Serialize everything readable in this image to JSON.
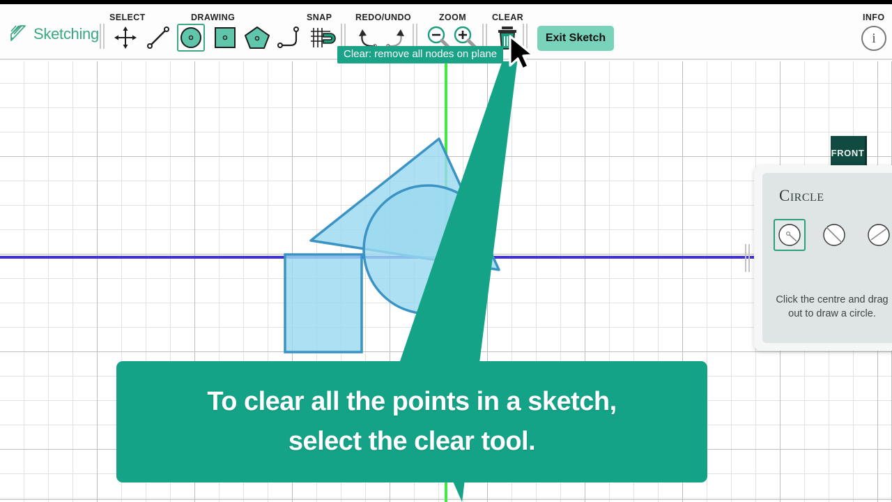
{
  "app": {
    "name": "Sketching",
    "logo_icon": "pencil-icon"
  },
  "toolbar": {
    "groups": [
      {
        "label": "SELECT"
      },
      {
        "label": "DRAWING"
      },
      {
        "label": "SNAP"
      },
      {
        "label": "REDO/UNDO"
      },
      {
        "label": "ZOOM"
      },
      {
        "label": "CLEAR"
      },
      {
        "label": "INFO"
      }
    ],
    "tools": {
      "move": "move-crosshair-icon",
      "line": "line-tool-icon",
      "circle": "circle-tool-icon",
      "square": "square-tool-icon",
      "pentagon": "pentagon-tool-icon",
      "fillet": "fillet-tool-icon",
      "snap": "snap-magnet-icon",
      "undo": "undo-arrow-icon",
      "redo": "redo-arrow-icon",
      "zoom_out": "zoom-out-icon",
      "zoom_in": "zoom-in-icon",
      "clear": "trash-icon"
    },
    "selected_tool": "circle",
    "exit_label": "Exit Sketch",
    "info_glyph": "i"
  },
  "tooltip": {
    "text": "Clear: remove all nodes on plane"
  },
  "viewcube": {
    "label": "FRONT"
  },
  "panel": {
    "title": "Circle",
    "options": [
      {
        "name": "centre-radius",
        "selected": true
      },
      {
        "name": "two-point-diameter",
        "selected": false
      },
      {
        "name": "three-point",
        "selected": false
      }
    ],
    "help_text": "Click the centre and drag out to draw a circle."
  },
  "caption": {
    "line1": "To clear all the points in a sketch,",
    "line2": "select the clear tool."
  },
  "colors": {
    "brand_green": "#3aa882",
    "banner_teal": "#14a387",
    "shape_fill": "#9bd9f0",
    "shape_stroke": "#3b93c4",
    "axis_x": "#4030e0",
    "axis_y": "#44e844",
    "viewcube": "#114a41",
    "exit_button": "#79d3bb"
  },
  "canvas": {
    "shapes": [
      {
        "type": "triangle",
        "name": "sketch-triangle"
      },
      {
        "type": "rectangle",
        "name": "sketch-rectangle"
      },
      {
        "type": "circle",
        "name": "sketch-circle"
      }
    ],
    "axes": [
      {
        "name": "x-axis-line",
        "orientation": "horizontal"
      },
      {
        "name": "y-axis-line",
        "orientation": "vertical"
      }
    ],
    "pointer_cone": "pointer-cone"
  }
}
